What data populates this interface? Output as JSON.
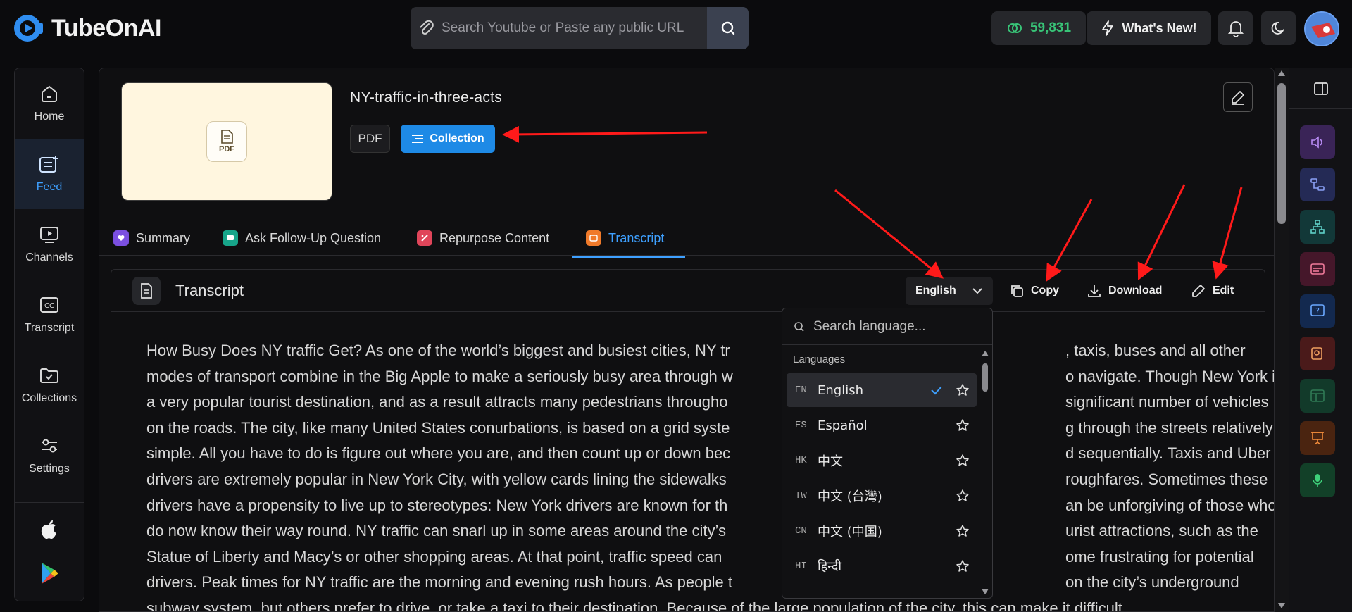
{
  "brand": {
    "name": "TubeOnAI"
  },
  "search": {
    "placeholder": "Search Youtube or Paste any public URL"
  },
  "header": {
    "credits": "59,831",
    "whats_new": "What's New!"
  },
  "nav": {
    "items": [
      {
        "label": "Home"
      },
      {
        "label": "Feed"
      },
      {
        "label": "Channels"
      },
      {
        "label": "Transcript"
      },
      {
        "label": "Collections"
      },
      {
        "label": "Settings"
      }
    ]
  },
  "document": {
    "title": "NY-traffic-in-three-acts",
    "type_chip": "PDF",
    "collection_chip": "Collection",
    "thumb_label": "PDF"
  },
  "tabs": [
    {
      "label": "Summary",
      "color": "#7b4fe0"
    },
    {
      "label": "Ask Follow-Up Question",
      "color": "#17a58a"
    },
    {
      "label": "Repurpose Content",
      "color": "#e0455a"
    },
    {
      "label": "Transcript",
      "color": "#f07a2a"
    }
  ],
  "transcript_panel": {
    "title": "Transcript",
    "language": "English",
    "copy": "Copy",
    "download": "Download",
    "edit": "Edit",
    "lines": [
      "How Busy Does NY traffic Get? As one of the world’s biggest and busiest cities, NY tr",
      "modes of transport combine in the Big Apple to make a seriously busy area through w",
      "a very popular tourist destination, and as a result attracts many pedestrians througho",
      "on the roads. The city, like many United States conurbations, is based on a grid syste",
      "simple. All you have to do is figure out where you are, and then count up or down bec",
      "drivers are extremely popular in New York City, with yellow cards lining the sidewalks",
      "drivers have a propensity to live up to stereotypes: New York drivers are known for th",
      "do now know their way round. NY traffic can snarl up in some areas around the city’s",
      "Statue of Liberty and Macy’s or other shopping areas. At that point, traffic speed can",
      "drivers. Peak times for NY traffic are the morning and evening rush hours. As people t",
      "subway system, but others prefer to drive, or take a taxi to their destination. Because of the large population of the city, this can make it difficult"
    ],
    "lines_right": [
      ", taxis, buses and all other",
      "o navigate. Though New York is",
      "significant number of vehicles",
      "g through the streets relatively",
      "d sequentially. Taxis and Uber",
      "roughfares. Sometimes these",
      "an be unforgiving of those who",
      "urist attractions, such as the",
      "ome frustrating for potential",
      "on the city’s underground",
      ""
    ]
  },
  "language_dropdown": {
    "search_placeholder": "Search language...",
    "section_label": "Languages",
    "items": [
      {
        "code": "EN",
        "name": "English",
        "selected": true
      },
      {
        "code": "ES",
        "name": "Español",
        "selected": false
      },
      {
        "code": "HK",
        "name": "中文",
        "selected": false
      },
      {
        "code": "TW",
        "name": "中文 (台灣)",
        "selected": false
      },
      {
        "code": "CN",
        "name": "中文 (中国)",
        "selected": false
      },
      {
        "code": "HI",
        "name": "हिन्दी",
        "selected": false
      }
    ]
  },
  "colors": {
    "accent": "#1e8ae6",
    "link": "#3ea0ff",
    "credits": "#38c377",
    "annotation_arrow": "#ff1a1a"
  },
  "right_tools": [
    {
      "icon": "speaker-icon",
      "color": "#7a3fc4"
    },
    {
      "icon": "flow-icon",
      "color": "#3a4fc4"
    },
    {
      "icon": "mindmap-icon",
      "color": "#1a8a8a"
    },
    {
      "icon": "subtitles-icon",
      "color": "#b03050"
    },
    {
      "icon": "question-icon",
      "color": "#2a6ad4"
    },
    {
      "icon": "quiz-icon",
      "color": "#c0392b"
    },
    {
      "icon": "table-icon",
      "color": "#1f7a5a"
    },
    {
      "icon": "presentation-icon",
      "color": "#e06a1a"
    },
    {
      "icon": "mic-icon",
      "color": "#1f9a5a"
    }
  ]
}
